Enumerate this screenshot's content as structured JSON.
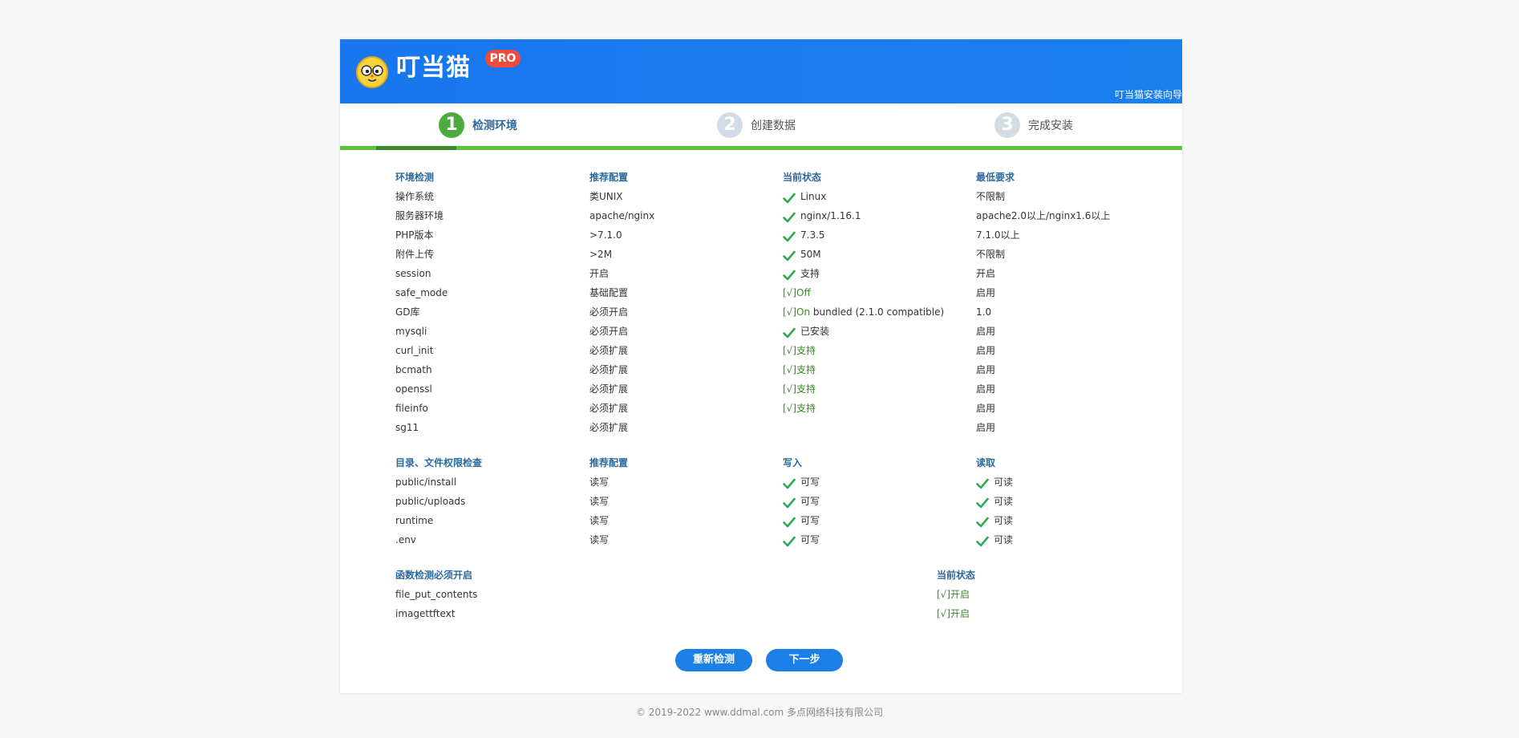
{
  "header": {
    "brand": "叮当猫",
    "badge": "PRO",
    "wizard_title": "叮当猫安装向导"
  },
  "steps": [
    {
      "num": "1",
      "label": "检测环境",
      "active": true
    },
    {
      "num": "2",
      "label": "创建数据",
      "active": false
    },
    {
      "num": "3",
      "label": "完成安装",
      "active": false
    }
  ],
  "env": {
    "headers": [
      "环境检测",
      "推荐配置",
      "当前状态",
      "最低要求"
    ],
    "rows": [
      {
        "name": "操作系统",
        "rec": "类UNIX",
        "status": "Linux",
        "status_style": "icon",
        "min": "不限制"
      },
      {
        "name": "服务器环境",
        "rec": "apache/nginx",
        "status": "nginx/1.16.1",
        "status_style": "icon",
        "min": "apache2.0以上/nginx1.6以上"
      },
      {
        "name": "PHP版本",
        "rec": ">7.1.0",
        "status": "7.3.5",
        "status_style": "icon",
        "min": "7.1.0以上"
      },
      {
        "name": "附件上传",
        "rec": ">2M",
        "status": "50M",
        "status_style": "icon",
        "min": "不限制"
      },
      {
        "name": "session",
        "rec": "开启",
        "status": "支持",
        "status_style": "icon",
        "min": "开启"
      },
      {
        "name": "safe_mode",
        "rec": "基础配置",
        "status": "[√]Off",
        "status_style": "bracket",
        "min": "启用"
      },
      {
        "name": "GD库",
        "rec": "必须开启",
        "status": "[√]On bundled (2.1.0 compatible)",
        "status_style": "bracket-mixed",
        "min": "1.0"
      },
      {
        "name": "mysqli",
        "rec": "必须开启",
        "status": "已安装",
        "status_style": "icon",
        "min": "启用"
      },
      {
        "name": "curl_init",
        "rec": "必须扩展",
        "status": "[√]支持",
        "status_style": "bracket",
        "min": "启用"
      },
      {
        "name": "bcmath",
        "rec": "必须扩展",
        "status": "[√]支持",
        "status_style": "bracket",
        "min": "启用"
      },
      {
        "name": "openssl",
        "rec": "必须扩展",
        "status": "[√]支持",
        "status_style": "bracket",
        "min": "启用"
      },
      {
        "name": "fileinfo",
        "rec": "必须扩展",
        "status": "[√]支持",
        "status_style": "bracket",
        "min": "启用"
      },
      {
        "name": "sg11",
        "rec": "必须扩展",
        "status": "",
        "status_style": "none",
        "min": "启用"
      }
    ]
  },
  "dirs": {
    "headers": [
      "目录、文件权限检查",
      "推荐配置",
      "写入",
      "读取"
    ],
    "rows": [
      {
        "name": "public/install",
        "rec": "读写",
        "write": "可写",
        "read": "可读"
      },
      {
        "name": "public/uploads",
        "rec": "读写",
        "write": "可写",
        "read": "可读"
      },
      {
        "name": "runtime",
        "rec": "读写",
        "write": "可写",
        "read": "可读"
      },
      {
        "name": ".env",
        "rec": "读写",
        "write": "可写",
        "read": "可读"
      }
    ]
  },
  "funcs": {
    "headers": [
      "函数检测必须开启",
      "当前状态"
    ],
    "rows": [
      {
        "name": "file_put_contents",
        "status": "[√]开启"
      },
      {
        "name": "imagettftext",
        "status": "[√]开启"
      }
    ]
  },
  "buttons": {
    "recheck": "重新检测",
    "next": "下一步"
  },
  "footer": "© 2019-2022 www.ddmal.com 多点网络科技有限公司",
  "colors": {
    "header": "#1976ee",
    "step_active": "#4caa3f",
    "progress": "#5ac33a",
    "section_head": "#2b6aa0",
    "ok_green": "#3a8a2a",
    "button": "#1a7fe6",
    "badge": "#ef4a3a"
  }
}
